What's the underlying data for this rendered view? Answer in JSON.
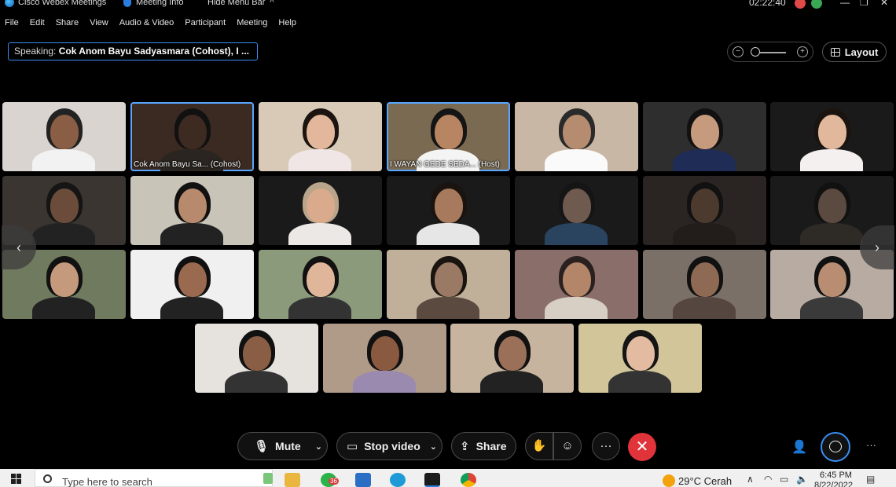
{
  "titlebar": {
    "app_title": "Cisco Webex Meetings",
    "meeting_info": "Meeting Info",
    "hide_menu": "Hide Menu Bar",
    "caret": "^",
    "clock": "02:22:40",
    "minimize": "—",
    "restore": "❐",
    "close": "✕"
  },
  "menu": [
    "File",
    "Edit",
    "Share",
    "View",
    "Audio & Video",
    "Participant",
    "Meeting",
    "Help"
  ],
  "speaking": {
    "prefix": "Speaking:",
    "name": "Cok Anom Bayu Sadyasmara (Cohost), I ..."
  },
  "zoom": {
    "minus": "−",
    "plus": "+"
  },
  "layout_label": "Layout",
  "tiles": [
    {
      "label": "",
      "bg": "#d9d4cf",
      "skin": "#8a5e45",
      "shirt": "#f2f2f2",
      "hair": "#222"
    },
    {
      "label": "Cok Anom Bayu Sa... (Cohost)",
      "bg": "#3a2a22",
      "skin": "#3d2a20",
      "shirt": "#2a2520",
      "hair": "#111"
    },
    {
      "label": "",
      "bg": "#d8cab6",
      "skin": "#e3b79b",
      "shirt": "#f0e6e6",
      "hair": "#1b1410"
    },
    {
      "label": "I WAYAN GEDE SEDA... (Host)",
      "bg": "#7a6a52",
      "skin": "#b88562",
      "shirt": "#f4f4f4",
      "hair": "#151515"
    },
    {
      "label": "",
      "bg": "#c8b7a4",
      "skin": "#b58c70",
      "shirt": "#fafafa",
      "hair": "#2a2a2a"
    },
    {
      "label": "",
      "bg": "#2e2e2e",
      "skin": "#c69a7c",
      "shirt": "#1f2c55",
      "hair": "#111"
    },
    {
      "label": "",
      "bg": "#1a1a1a",
      "skin": "#e1b89c",
      "shirt": "#f5f0f0",
      "hair": "#1a1410"
    },
    {
      "label": "",
      "bg": "#3a3530",
      "skin": "#6b4c3a",
      "shirt": "#222",
      "hair": "#151515"
    },
    {
      "label": "",
      "bg": "#c9c4b8",
      "skin": "#b88a6d",
      "shirt": "#222",
      "hair": "#111"
    },
    {
      "label": "",
      "bg": "#1a1a1a",
      "skin": "#d9aa8c",
      "shirt": "#ece8e5",
      "hair": "#b9a58c"
    },
    {
      "label": "",
      "bg": "#1a1a1a",
      "skin": "#a87a5d",
      "shirt": "#e6e6e6",
      "hair": "#1a1410"
    },
    {
      "label": "",
      "bg": "#1a1a1a",
      "skin": "#6e5a4f",
      "shirt": "#2a4460",
      "hair": "#151515"
    },
    {
      "label": "",
      "bg": "#2a2522",
      "skin": "#4d3a2e",
      "shirt": "#221d1a",
      "hair": "#111"
    },
    {
      "label": "",
      "bg": "#1a1a1a",
      "skin": "#5a4a40",
      "shirt": "#2e2a26",
      "hair": "#111"
    },
    {
      "label": "",
      "bg": "#6f7a5e",
      "skin": "#c59a7c",
      "shirt": "#222",
      "hair": "#111"
    },
    {
      "label": "",
      "bg": "#f0f0f0",
      "skin": "#9a6a50",
      "shirt": "#222",
      "hair": "#111"
    },
    {
      "label": "",
      "bg": "#8a9a7a",
      "skin": "#e0b69a",
      "shirt": "#333",
      "hair": "#111"
    },
    {
      "label": "",
      "bg": "#c0b09a",
      "skin": "#9a7a64",
      "shirt": "#5a4a40",
      "hair": "#1a1410"
    },
    {
      "label": "",
      "bg": "#8a6e6a",
      "skin": "#b38669",
      "shirt": "#d8cfc4",
      "hair": "#2a2020"
    },
    {
      "label": "",
      "bg": "#7a7068",
      "skin": "#8e6a55",
      "shirt": "#554640",
      "hair": "#111"
    },
    {
      "label": "",
      "bg": "#b8aca2",
      "skin": "#b88d71",
      "shirt": "#3a3a3a",
      "hair": "#111"
    },
    {
      "label": "",
      "bg": "#e6e2de",
      "skin": "#8a5e45",
      "shirt": "#333",
      "hair": "#111"
    },
    {
      "label": "",
      "bg": "#b09a88",
      "skin": "#8a5a40",
      "shirt": "#9a8ab0",
      "hair": "#111"
    },
    {
      "label": "",
      "bg": "#c7b49e",
      "skin": "#9a7058",
      "shirt": "#222",
      "hair": "#111"
    },
    {
      "label": "",
      "bg": "#d2c59a",
      "skin": "#e3bba0",
      "shirt": "#333",
      "hair": "#151515"
    }
  ],
  "controls": {
    "mute": "Mute",
    "stop_video": "Stop video",
    "share": "Share",
    "more": "···"
  },
  "taskbar": {
    "search_placeholder": "Type here to search",
    "weather": "29°C  Cerah",
    "time": "6:45 PM",
    "date": "8/22/2022",
    "whatsapp_badge": "36"
  }
}
